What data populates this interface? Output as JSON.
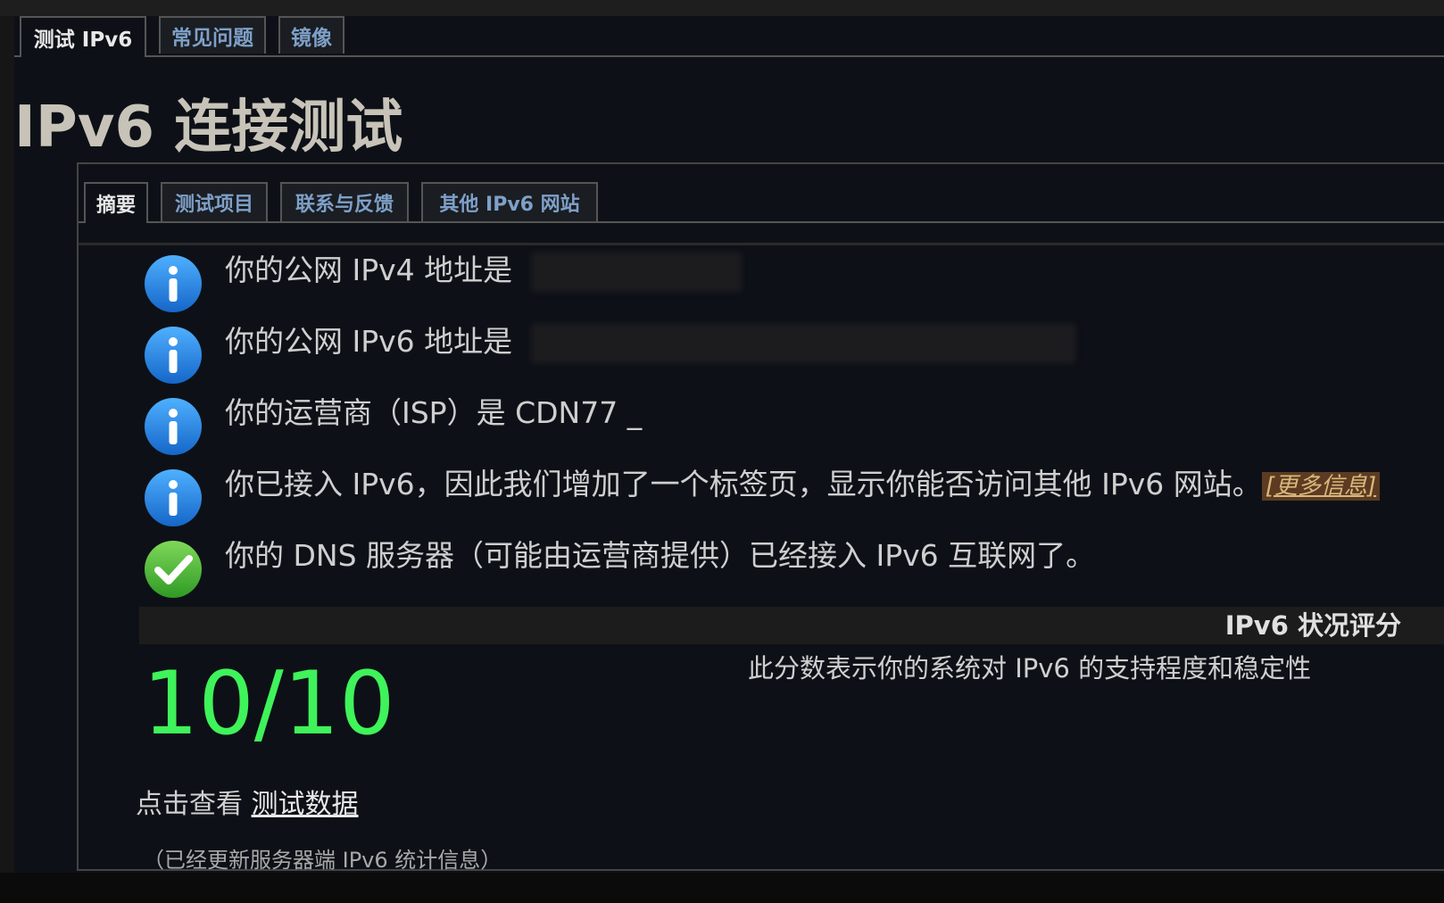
{
  "top_tabs": [
    "测试 IPv6",
    "常见问题",
    "镜像"
  ],
  "page_title": "IPv6 连接测试",
  "inner_tabs": [
    "摘要",
    "测试项目",
    "联系与反馈",
    "其他 IPv6 网站"
  ],
  "messages": [
    {
      "icon": "info-icon",
      "text": "你的公网 IPv4 地址是"
    },
    {
      "icon": "info-icon",
      "text": "你的公网 IPv6 地址是"
    },
    {
      "icon": "info-icon",
      "text": "你的运营商（ISP）是 CDN77 _"
    },
    {
      "icon": "info-icon",
      "text": "你已接入 IPv6，因此我们增加了一个标签页，显示你能否访问其他 IPv6 网站。",
      "link": "[更多信息]"
    },
    {
      "icon": "check-icon",
      "text": "你的 DNS 服务器（可能由运营商提供）已经接入 IPv6 互联网了。"
    }
  ],
  "score": {
    "heading": "IPv6 状况评分",
    "description": "此分数表示你的系统对 IPv6 的支持程度和稳定性",
    "value": "10/10",
    "value_color": "#3ff35a"
  },
  "footer": {
    "click_prefix": "点击查看",
    "click_link": "测试数据",
    "updated": "（已经更新服务器端 IPv6 统计信息）"
  },
  "colors": {
    "background": "#0d1117",
    "tab_text": "#7ea0c8",
    "info_icon": "#1f8ae6",
    "check_icon": "#4cb33a"
  }
}
